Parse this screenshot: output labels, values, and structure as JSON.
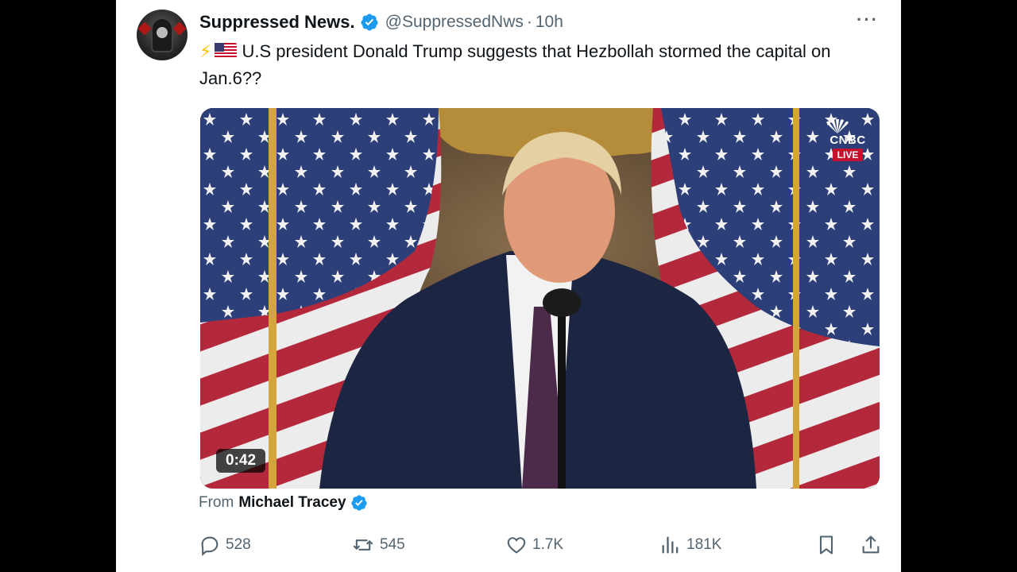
{
  "tweet": {
    "author_name": "Suppressed News.",
    "handle": "@SuppressedNws",
    "time": "10h",
    "text": "U.S president Donald Trump suggests that Hezbollah stormed the capital on Jan.6??",
    "emoji": "⚡",
    "more_label": "···"
  },
  "media": {
    "duration": "0:42",
    "network_logo": "CNBC",
    "live_badge": "LIVE",
    "from_label": "From",
    "from_name": "Michael Tracey"
  },
  "actions": {
    "replies": "528",
    "reposts": "545",
    "likes": "1.7K",
    "views": "181K"
  },
  "colors": {
    "verified": "#1d9bf0",
    "text": "#0f1419",
    "secondary": "#536471",
    "live": "#c4122f"
  },
  "icons": [
    "verified-badge-icon",
    "more-icon",
    "reply-icon",
    "repost-icon",
    "like-icon",
    "views-icon",
    "bookmark-icon",
    "share-icon"
  ]
}
